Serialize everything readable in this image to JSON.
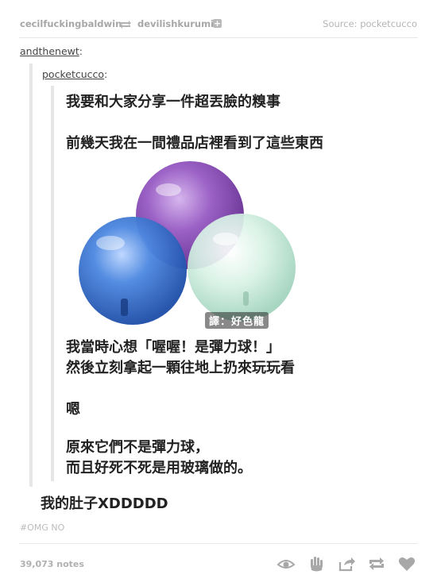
{
  "header": {
    "reblogger": "cecilfuckingbaldwin",
    "reblogged_from": "devilishkurumi",
    "follow_icon": "plus-icon",
    "source_label": "Source:",
    "source_name": "pocketcucco"
  },
  "thread": {
    "outer_user": "andthenewt",
    "inner_user": "pocketcucco",
    "paragraphs": [
      "我要和大家分享一件超丟臉的糗事",
      "前幾天我在一間禮品店裡看到了這些東西"
    ],
    "image_caption": "譯：好色龍",
    "after_lines": [
      "我當時心想「喔喔！是彈力球！」",
      "然後立刻拿起一顆往地上扔來玩玩看",
      "嗯",
      "原來它們不是彈力球，",
      "而且好死不死是用玻璃做的。"
    ],
    "reply": "我的肚子XDDDDD"
  },
  "footer": {
    "tag": "#OMG NO",
    "notes": "39,073 notes",
    "icons": [
      "eye-icon",
      "hand-icon",
      "share-icon",
      "reblog-icon",
      "heart-icon"
    ]
  },
  "colors": {
    "accent_gray": "#a7a7a7",
    "text_dark": "#222222",
    "ball_purple": "#8a4fb0",
    "ball_blue": "#2f6fcc",
    "ball_mint": "#bfe7d5"
  }
}
